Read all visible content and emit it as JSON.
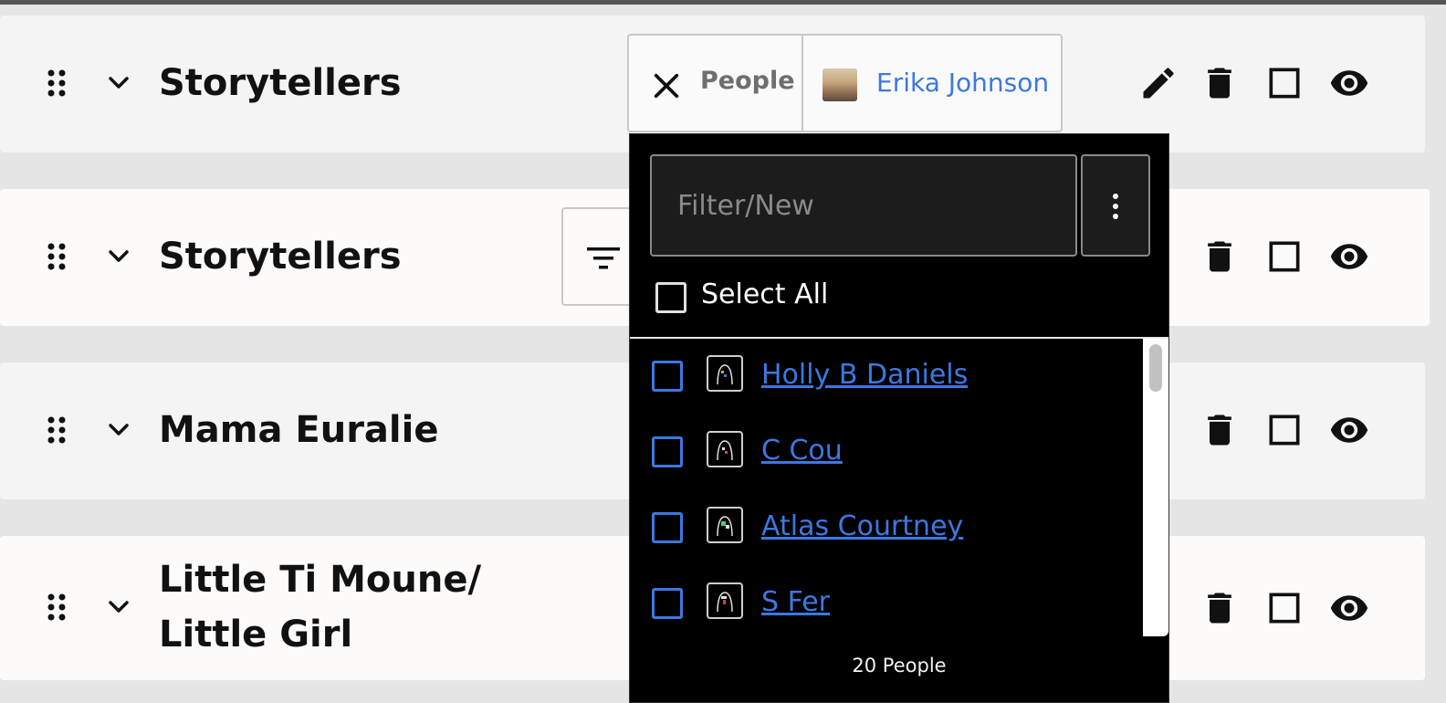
{
  "rows": [
    {
      "title": "Storytellers"
    },
    {
      "title": "Storytellers"
    },
    {
      "title": "Mama Euralie"
    },
    {
      "title": "Little Ti Moune/ Little Girl"
    }
  ],
  "filter_chip": {
    "label": "People",
    "selected_person": "Erika Johnson"
  },
  "dropdown": {
    "filter_placeholder": "Filter/New",
    "select_all_label": "Select All",
    "people": [
      {
        "name": "Holly B Daniels"
      },
      {
        "name": "C Cou"
      },
      {
        "name": "Atlas Courtney"
      },
      {
        "name": "S Fer"
      }
    ],
    "count_label": "20 People"
  },
  "icons": {
    "drag": "drag-handle-icon",
    "expand": "chevron-down-icon",
    "edit": "pencil-icon",
    "delete": "trash-icon",
    "select": "checkbox-icon",
    "visibility": "eye-icon",
    "remove_filter": "close-icon",
    "filter": "filter-icon",
    "more": "more-vert-icon"
  },
  "colors": {
    "link_blue": "#3b78e2",
    "dropdown_bg": "#000000"
  }
}
